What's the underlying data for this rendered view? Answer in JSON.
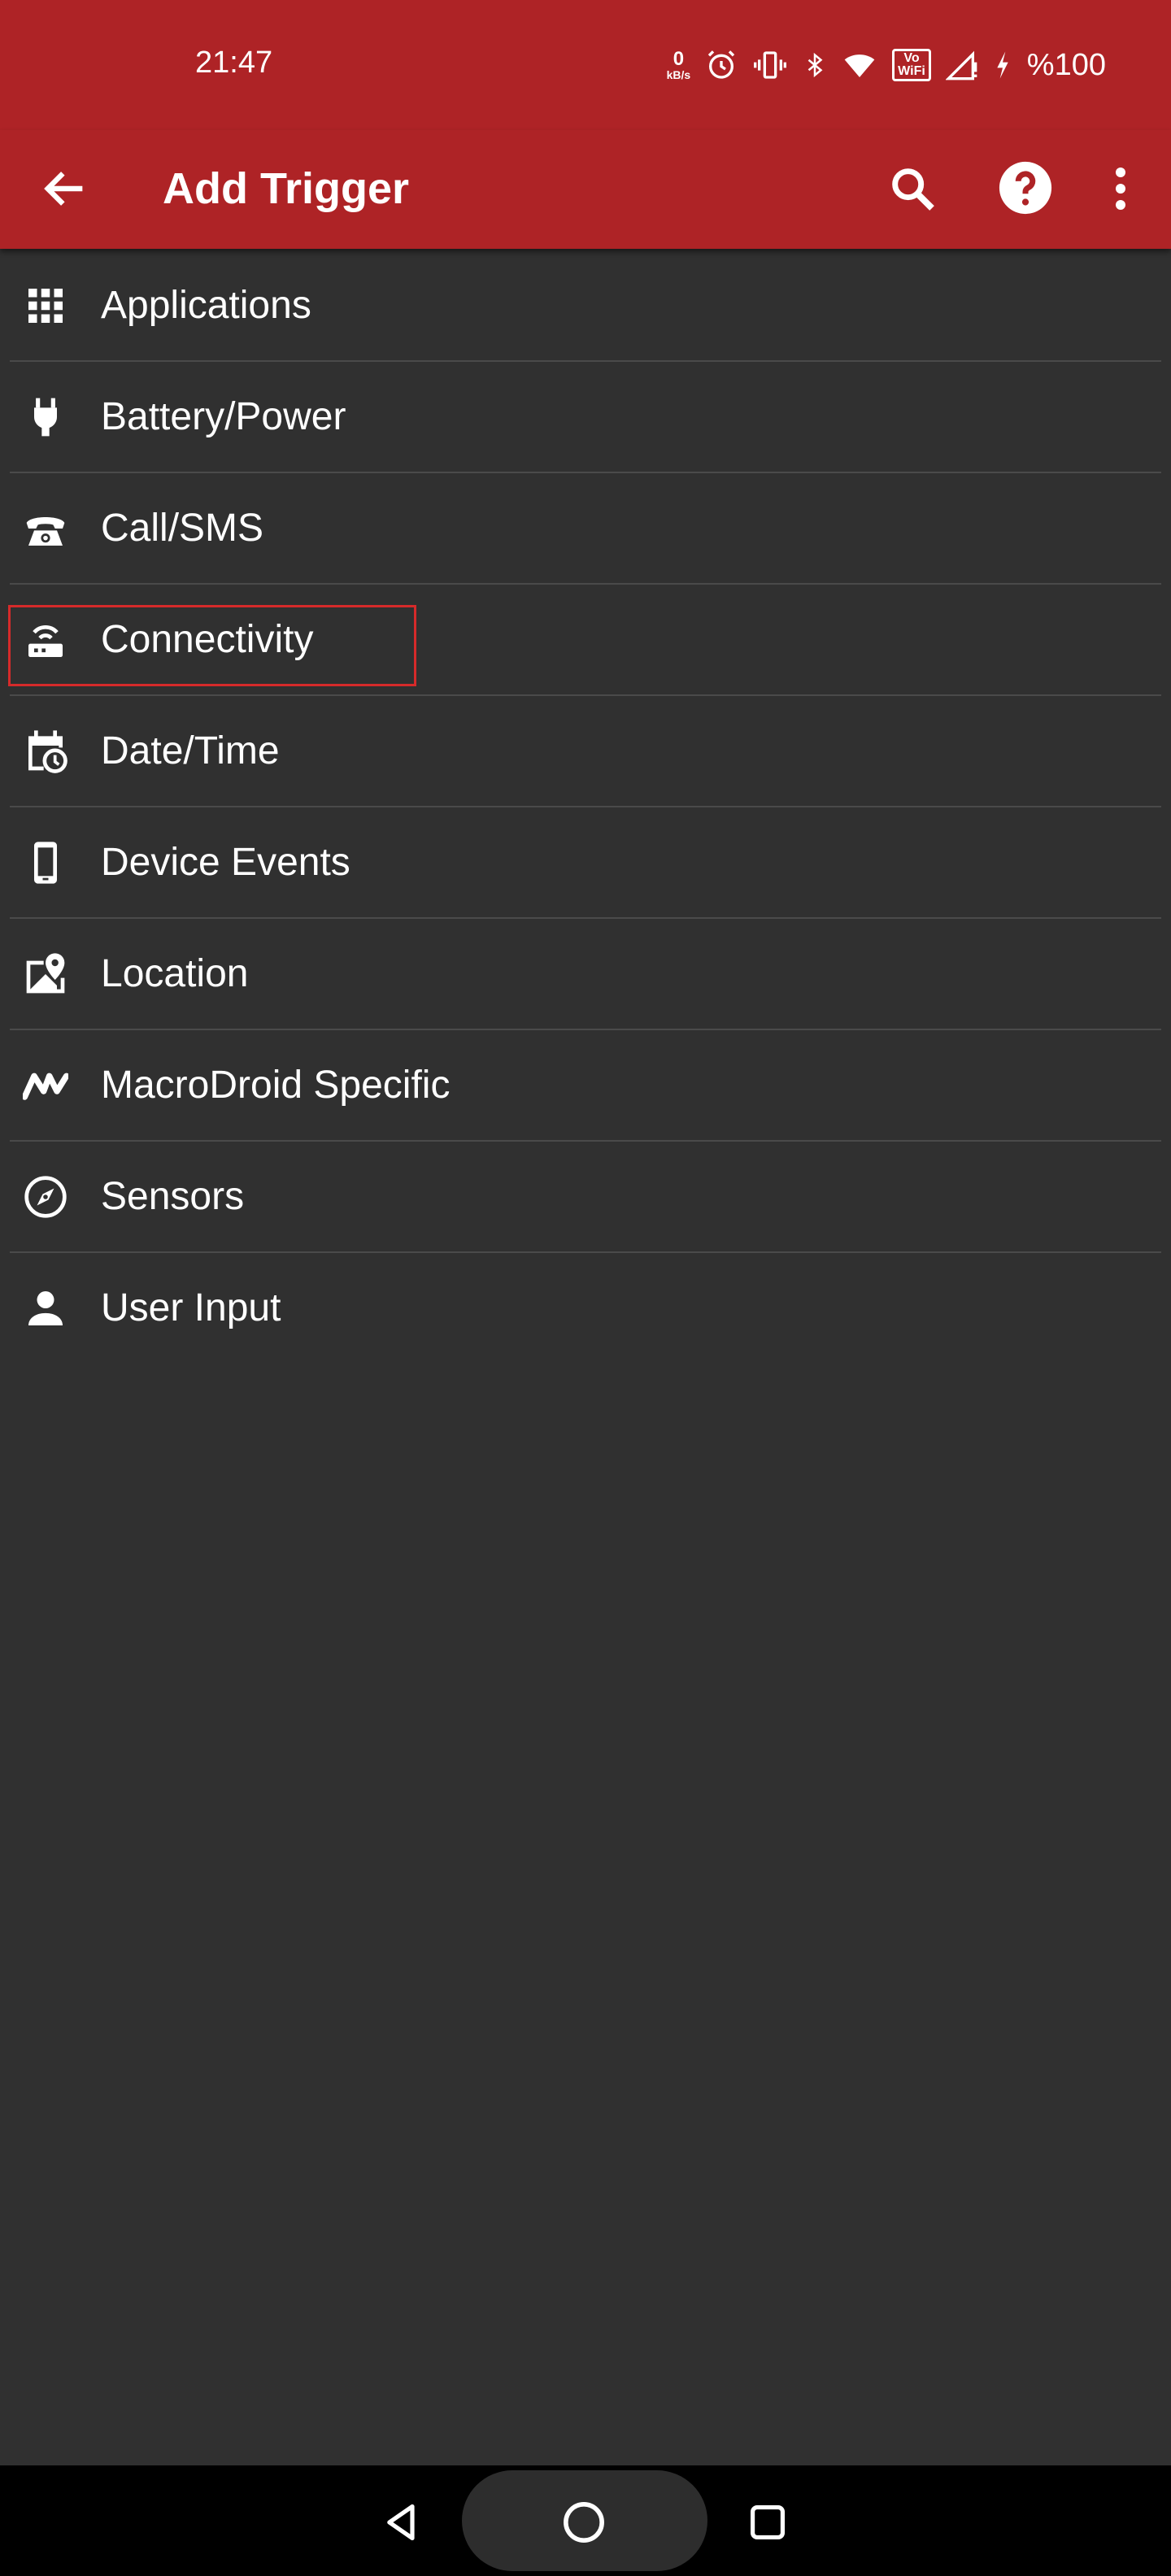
{
  "status_bar": {
    "time": "21:47",
    "net_speed_value": "0",
    "net_speed_unit": "kB/s",
    "volte_line1": "Vo",
    "volte_line2": "WiFi",
    "battery": "%100",
    "icons": [
      "alarm-icon",
      "vibrate-icon",
      "bluetooth-icon",
      "wifi-icon",
      "volte-wifi-icon",
      "signal-icon",
      "charging-icon"
    ]
  },
  "app_bar": {
    "title": "Add Trigger",
    "icons": [
      "back-arrow-icon",
      "search-icon",
      "help-icon",
      "more-vert-icon"
    ]
  },
  "categories": [
    {
      "label": "Applications",
      "icon": "apps-grid-icon"
    },
    {
      "label": "Battery/Power",
      "icon": "power-plug-icon"
    },
    {
      "label": "Call/SMS",
      "icon": "phone-icon"
    },
    {
      "label": "Connectivity",
      "icon": "router-icon"
    },
    {
      "label": "Date/Time",
      "icon": "calendar-clock-icon"
    },
    {
      "label": "Device Events",
      "icon": "smartphone-icon"
    },
    {
      "label": "Location",
      "icon": "map-pin-icon"
    },
    {
      "label": "MacroDroid Specific",
      "icon": "macrodroid-logo-icon"
    },
    {
      "label": "Sensors",
      "icon": "compass-icon"
    },
    {
      "label": "User Input",
      "icon": "person-icon"
    }
  ],
  "colors": {
    "app_bar": "#ae2326",
    "background": "#303030",
    "divider": "#4a4a4a",
    "highlight": "#d62a2a"
  },
  "nav_bar": {
    "icons": [
      "nav-back-icon",
      "nav-home-icon",
      "nav-recent-icon"
    ]
  }
}
